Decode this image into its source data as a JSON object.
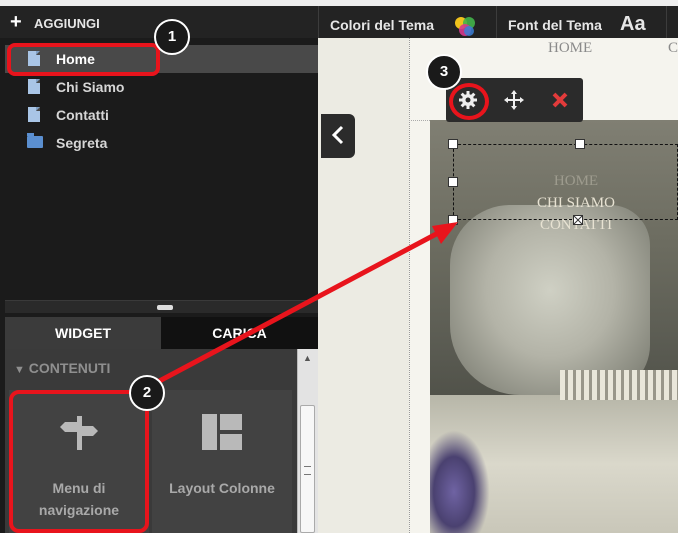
{
  "topbar": {
    "add_label": "AGGIUNGI",
    "theme_colors_label": "Colori del Tema",
    "theme_font_label": "Font del Tema",
    "font_icon_text": "Aa"
  },
  "pages": [
    {
      "label": "Home",
      "type": "page",
      "active": true
    },
    {
      "label": "Chi Siamo",
      "type": "page",
      "active": false
    },
    {
      "label": "Contatti",
      "type": "page",
      "active": false
    },
    {
      "label": "Segreta",
      "type": "folder",
      "active": false
    }
  ],
  "tabs": {
    "widget": "WIDGET",
    "carica": "CARICA"
  },
  "section": {
    "title": "CONTENUTI"
  },
  "widgets": [
    {
      "line1": "Menu di",
      "line2": "navigazione",
      "icon": "signpost-icon"
    },
    {
      "line1": "Layout Colonne",
      "line2": "",
      "icon": "layout-icon"
    }
  ],
  "site": {
    "nav_home": "HOME",
    "nav_partial": "C",
    "menu_items": [
      "HOME",
      "CHI SIAMO",
      "CONTATTI"
    ]
  },
  "callouts": [
    "1",
    "2",
    "3"
  ],
  "colors": {
    "highlight": "#e8141c",
    "accent_blue": "#5b8fd0"
  }
}
